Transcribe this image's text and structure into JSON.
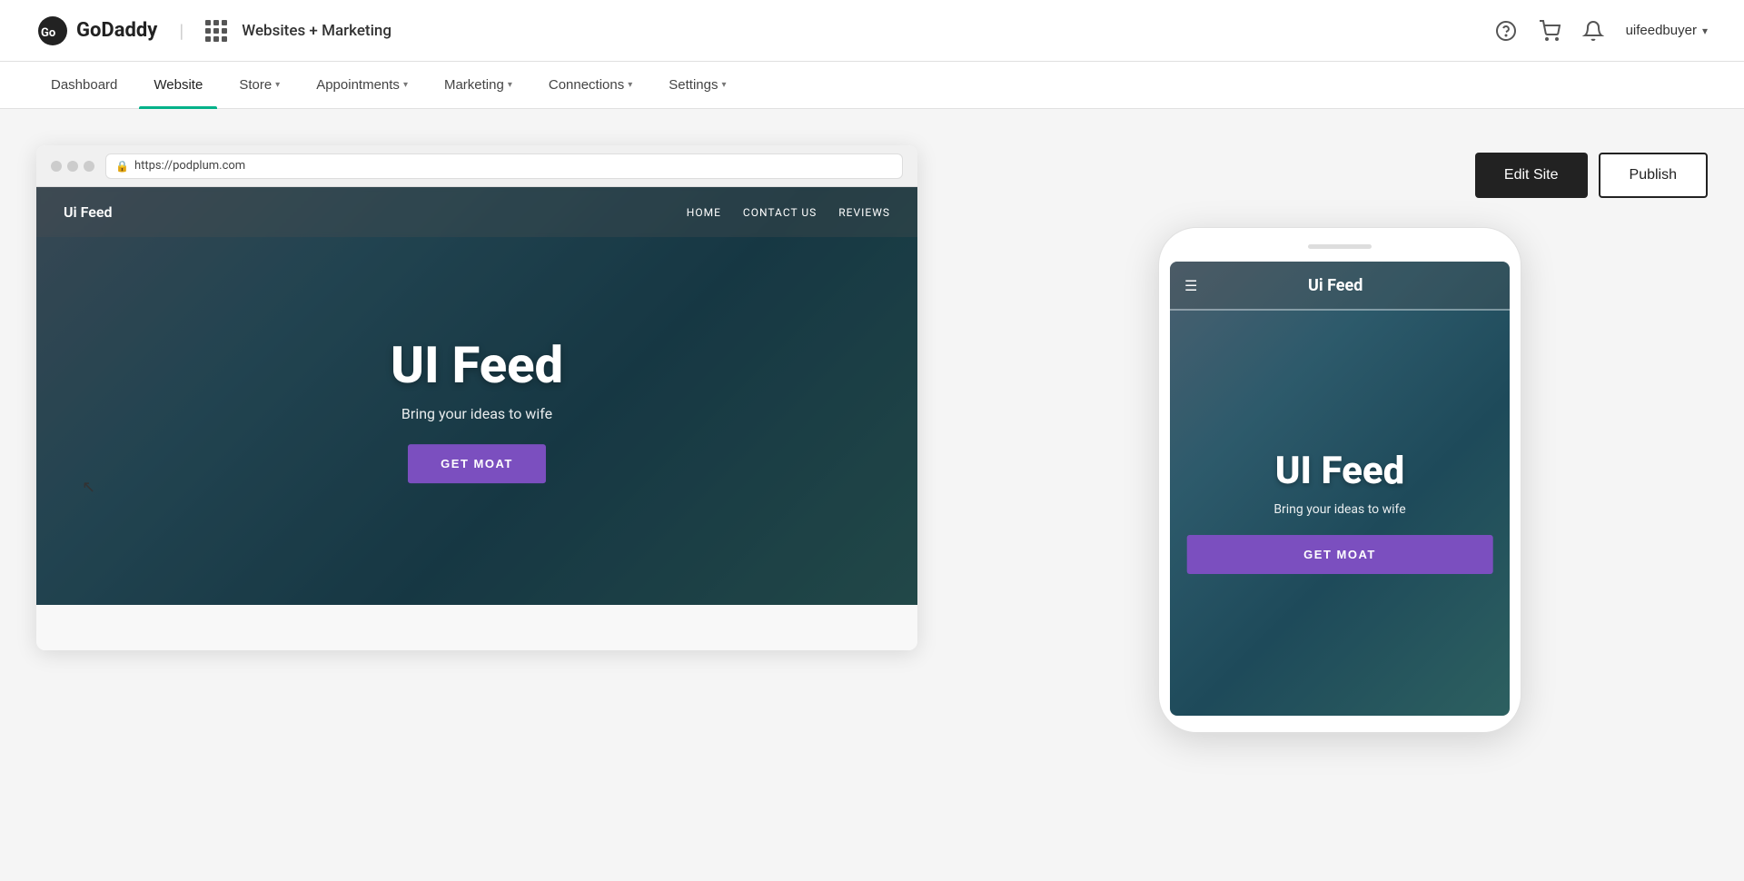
{
  "brand": {
    "logo_text": "GoDaddy",
    "divider": "|",
    "product_name": "Websites + Marketing"
  },
  "header": {
    "help_icon": "?",
    "cart_icon": "🛒",
    "bell_icon": "🔔",
    "username": "uifeedbuyer",
    "chevron": "▾"
  },
  "nav": {
    "items": [
      {
        "label": "Dashboard",
        "active": false,
        "has_dropdown": false
      },
      {
        "label": "Website",
        "active": true,
        "has_dropdown": false
      },
      {
        "label": "Store",
        "active": false,
        "has_dropdown": true
      },
      {
        "label": "Appointments",
        "active": false,
        "has_dropdown": true
      },
      {
        "label": "Marketing",
        "active": false,
        "has_dropdown": true
      },
      {
        "label": "Connections",
        "active": false,
        "has_dropdown": true
      },
      {
        "label": "Settings",
        "active": false,
        "has_dropdown": true
      }
    ]
  },
  "toolbar": {
    "edit_site_label": "Edit Site",
    "publish_label": "Publish"
  },
  "browser": {
    "url": "https://podplum.com"
  },
  "website": {
    "brand": "Ui Feed",
    "nav_links": [
      "HOME",
      "CONTACT US",
      "REVIEWS"
    ],
    "hero_title": "UI Feed",
    "hero_subtitle": "Bring your ideas to wife",
    "cta_button": "GET MOAT"
  },
  "mobile": {
    "brand": "Ui Feed",
    "hero_title": "UI Feed",
    "hero_subtitle": "Bring your ideas to wife",
    "cta_button": "GET MOAT"
  }
}
